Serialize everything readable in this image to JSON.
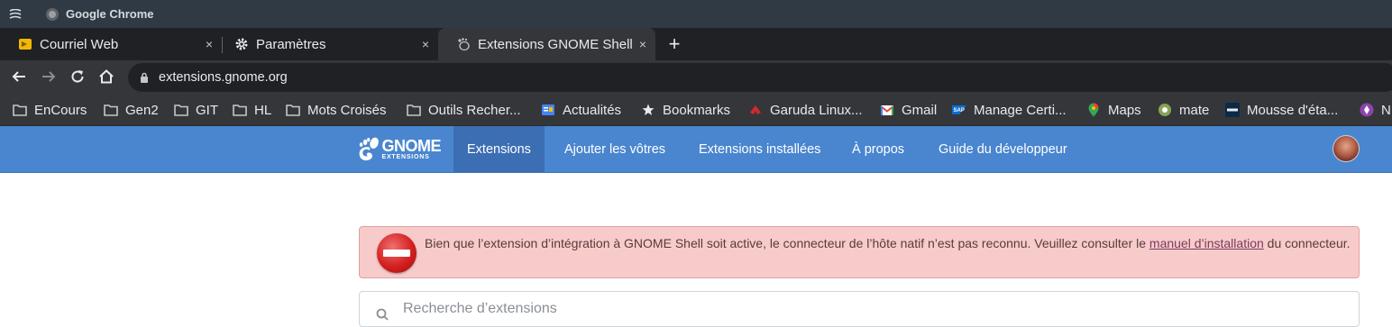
{
  "window": {
    "title": "Google Chrome"
  },
  "tabs": [
    {
      "label": "Courriel Web",
      "close": "×"
    },
    {
      "label": "Paramètres",
      "close": "×"
    },
    {
      "label": "Extensions GNOME Shell",
      "close": "×",
      "active": true
    }
  ],
  "new_tab": "+",
  "toolbar": {
    "url": "extensions.gnome.org"
  },
  "bookmarks": [
    {
      "label": "EnCours",
      "icon": "folder-icon"
    },
    {
      "label": "Gen2",
      "icon": "folder-icon"
    },
    {
      "label": "GIT",
      "icon": "folder-icon"
    },
    {
      "label": "HL",
      "icon": "folder-icon"
    },
    {
      "label": "Mots Croisés",
      "icon": "folder-icon"
    },
    {
      "label": "Outils Recher...",
      "icon": "folder-icon"
    },
    {
      "label": "Actualités",
      "icon": "google-news-icon"
    },
    {
      "label": "Bookmarks",
      "icon": "star-icon"
    },
    {
      "label": "Garuda Linux...",
      "icon": "garuda-icon"
    },
    {
      "label": "Gmail",
      "icon": "gmail-icon"
    },
    {
      "label": "Manage Certi...",
      "icon": "sap-icon"
    },
    {
      "label": "Maps",
      "icon": "maps-icon"
    },
    {
      "label": "mate",
      "icon": "mate-icon"
    },
    {
      "label": "Mousse d'éta...",
      "icon": "sonar-icon"
    },
    {
      "label": "N",
      "icon": "purple-icon"
    }
  ],
  "gnome": {
    "logo_text": "GNOME",
    "logo_sub": "EXTENSIONS",
    "nav": [
      "Extensions",
      "Ajouter les vôtres",
      "Extensions installées",
      "À propos",
      "Guide du développeur"
    ]
  },
  "alert": {
    "text_before": "Bien que l’extension d’intégration à GNOME Shell soit active, le connecteur de l’hôte natif n’est pas reconnu. Veuillez consulter le ",
    "link": "manuel d’installation",
    "text_after": " du connecteur."
  },
  "search": {
    "placeholder": "Recherche d’extensions"
  },
  "colors": {
    "gnome_blue": "#4a86cf",
    "alert_bg": "#f8cbcb",
    "chrome_dark": "#35363a"
  }
}
